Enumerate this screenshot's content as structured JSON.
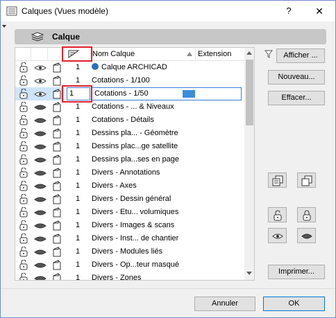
{
  "window": {
    "title": "Calques (Vues modèle)",
    "help": "?",
    "close": "✕"
  },
  "section": {
    "title": "Calque"
  },
  "list": {
    "columns": {
      "name": "Nom Calque",
      "extension": "Extension"
    },
    "rows": [
      {
        "num": "1",
        "name": "Calque ARCHICAD",
        "special": true
      },
      {
        "num": "1",
        "name": "Cotations - 1/100"
      },
      {
        "num": "1",
        "name": "Cotations - 1/50",
        "selected": true
      },
      {
        "num": "1",
        "name": "Cotations - ... & Niveaux"
      },
      {
        "num": "1",
        "name": "Cotations - Détails"
      },
      {
        "num": "1",
        "name": "Dessins pla... - Géomètre"
      },
      {
        "num": "1",
        "name": "Dessins plac...ge satellite"
      },
      {
        "num": "1",
        "name": "Dessins pla...ses en page"
      },
      {
        "num": "1",
        "name": "Divers - Annotations"
      },
      {
        "num": "1",
        "name": "Divers - Axes"
      },
      {
        "num": "1",
        "name": "Divers - Dessin général"
      },
      {
        "num": "1",
        "name": "Divers - Etu... volumiques"
      },
      {
        "num": "1",
        "name": "Divers - Images & scans"
      },
      {
        "num": "1",
        "name": "Divers - Inst... de chantier"
      },
      {
        "num": "1",
        "name": "Divers - Modules liés"
      },
      {
        "num": "1",
        "name": "Divers - Op...teur masqué"
      },
      {
        "num": "1",
        "name": "Divers - Zones"
      }
    ]
  },
  "buttons": {
    "afficher": "Afficher ...",
    "nouveau": "Nouveau...",
    "effacer": "Effacer...",
    "imprimer": "Imprimer...",
    "annuler": "Annuler",
    "ok": "OK"
  },
  "colors": {
    "highlight_box": "#e0202b",
    "selection": "#cde4fb",
    "accent": "#3c8dde"
  }
}
